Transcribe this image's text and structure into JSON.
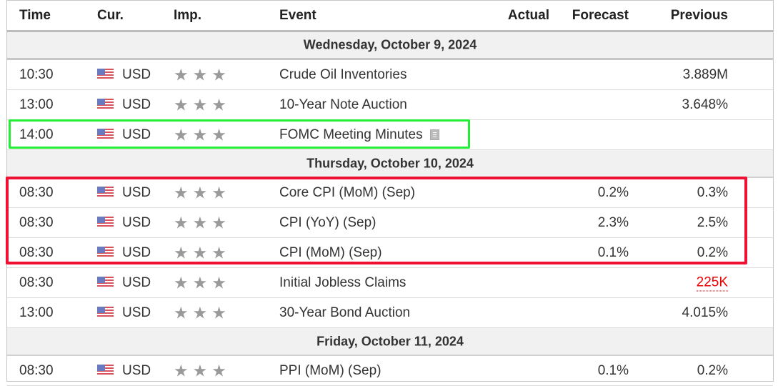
{
  "headers": {
    "time": "Time",
    "currency": "Cur.",
    "importance": "Imp.",
    "event": "Event",
    "actual": "Actual",
    "forecast": "Forecast",
    "previous": "Previous"
  },
  "star_glyph": "★",
  "days": [
    {
      "date": "Wednesday, October 9, 2024",
      "events": [
        {
          "time": "10:30",
          "currency": "USD",
          "importance": 3,
          "event": "Crude Oil Inventories",
          "actual": "",
          "forecast": "",
          "previous": "3.889M",
          "previous_negative": false,
          "has_doc_icon": false
        },
        {
          "time": "13:00",
          "currency": "USD",
          "importance": 3,
          "event": "10-Year Note Auction",
          "actual": "",
          "forecast": "",
          "previous": "3.648%",
          "previous_negative": false,
          "has_doc_icon": false
        },
        {
          "time": "14:00",
          "currency": "USD",
          "importance": 3,
          "event": "FOMC Meeting Minutes",
          "actual": "",
          "forecast": "",
          "previous": "",
          "previous_negative": false,
          "has_doc_icon": true
        }
      ]
    },
    {
      "date": "Thursday, October 10, 2024",
      "events": [
        {
          "time": "08:30",
          "currency": "USD",
          "importance": 3,
          "event": "Core CPI (MoM) (Sep)",
          "actual": "",
          "forecast": "0.2%",
          "previous": "0.3%",
          "previous_negative": false,
          "has_doc_icon": false
        },
        {
          "time": "08:30",
          "currency": "USD",
          "importance": 3,
          "event": "CPI (YoY) (Sep)",
          "actual": "",
          "forecast": "2.3%",
          "previous": "2.5%",
          "previous_negative": false,
          "has_doc_icon": false
        },
        {
          "time": "08:30",
          "currency": "USD",
          "importance": 3,
          "event": "CPI (MoM) (Sep)",
          "actual": "",
          "forecast": "0.1%",
          "previous": "0.2%",
          "previous_negative": false,
          "has_doc_icon": false
        },
        {
          "time": "08:30",
          "currency": "USD",
          "importance": 3,
          "event": "Initial Jobless Claims",
          "actual": "",
          "forecast": "",
          "previous": "225K",
          "previous_negative": true,
          "has_doc_icon": false
        },
        {
          "time": "13:00",
          "currency": "USD",
          "importance": 3,
          "event": "30-Year Bond Auction",
          "actual": "",
          "forecast": "",
          "previous": "4.015%",
          "previous_negative": false,
          "has_doc_icon": false
        }
      ]
    },
    {
      "date": "Friday, October 11, 2024",
      "events": [
        {
          "time": "08:30",
          "currency": "USD",
          "importance": 3,
          "event": "PPI (MoM) (Sep)",
          "actual": "",
          "forecast": "0.1%",
          "previous": "0.2%",
          "previous_negative": false,
          "has_doc_icon": false
        }
      ]
    }
  ],
  "highlights": [
    {
      "color": "#22ee33",
      "target": "FOMC Meeting Minutes row"
    },
    {
      "color": "#ee1133",
      "target": "CPI rows (Oct 10)"
    }
  ]
}
